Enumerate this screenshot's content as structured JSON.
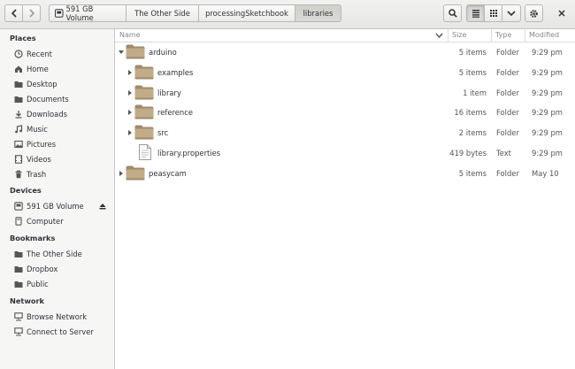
{
  "toolbar": {
    "breadcrumbs": [
      {
        "label": "591 GB Volume"
      },
      {
        "label": "The Other Side"
      },
      {
        "label": "processingSketchbook"
      },
      {
        "label": "libraries"
      }
    ]
  },
  "sidebar": {
    "places_heading": "Places",
    "places": [
      {
        "label": "Recent",
        "icon": "recent-icon"
      },
      {
        "label": "Home",
        "icon": "home-icon"
      },
      {
        "label": "Desktop",
        "icon": "desktop-icon"
      },
      {
        "label": "Documents",
        "icon": "documents-icon"
      },
      {
        "label": "Downloads",
        "icon": "downloads-icon"
      },
      {
        "label": "Music",
        "icon": "music-icon"
      },
      {
        "label": "Pictures",
        "icon": "pictures-icon"
      },
      {
        "label": "Videos",
        "icon": "videos-icon"
      },
      {
        "label": "Trash",
        "icon": "trash-icon"
      }
    ],
    "devices_heading": "Devices",
    "devices": [
      {
        "label": "591 GB Volume",
        "icon": "drive-icon"
      },
      {
        "label": "Computer",
        "icon": "computer-icon"
      }
    ],
    "bookmarks_heading": "Bookmarks",
    "bookmarks": [
      {
        "label": "The Other Side",
        "icon": "folder-icon"
      },
      {
        "label": "Dropbox",
        "icon": "folder-icon"
      },
      {
        "label": "Public",
        "icon": "folder-icon"
      }
    ],
    "network_heading": "Network",
    "network": [
      {
        "label": "Browse Network",
        "icon": "network-icon"
      },
      {
        "label": "Connect to Server",
        "icon": "server-icon"
      }
    ]
  },
  "columns": {
    "name": "Name",
    "size": "Size",
    "type": "Type",
    "modified": "Modified"
  },
  "files": [
    {
      "name": "arduino",
      "size": "5 items",
      "type": "Folder",
      "modified": "9:29 pm",
      "kind": "folder",
      "expanded": true,
      "depth": 0
    },
    {
      "name": "examples",
      "size": "5 items",
      "type": "Folder",
      "modified": "9:29 pm",
      "kind": "folder",
      "expanded": false,
      "depth": 1
    },
    {
      "name": "library",
      "size": "1 item",
      "type": "Folder",
      "modified": "9:29 pm",
      "kind": "folder",
      "expanded": false,
      "depth": 1
    },
    {
      "name": "reference",
      "size": "16 items",
      "type": "Folder",
      "modified": "9:29 pm",
      "kind": "folder",
      "expanded": false,
      "depth": 1
    },
    {
      "name": "src",
      "size": "2 items",
      "type": "Folder",
      "modified": "9:29 pm",
      "kind": "folder",
      "expanded": false,
      "depth": 1
    },
    {
      "name": "library.properties",
      "size": "419 bytes",
      "type": "Text",
      "modified": "9:29 pm",
      "kind": "text",
      "expanded": false,
      "depth": 1
    },
    {
      "name": "peasycam",
      "size": "5 items",
      "type": "Folder",
      "modified": "May 10",
      "kind": "folder",
      "expanded": false,
      "depth": 0
    }
  ],
  "colors": {
    "folder": "#a08a6a",
    "folder_light": "#c1ab89",
    "accent": "#4a90d9"
  }
}
